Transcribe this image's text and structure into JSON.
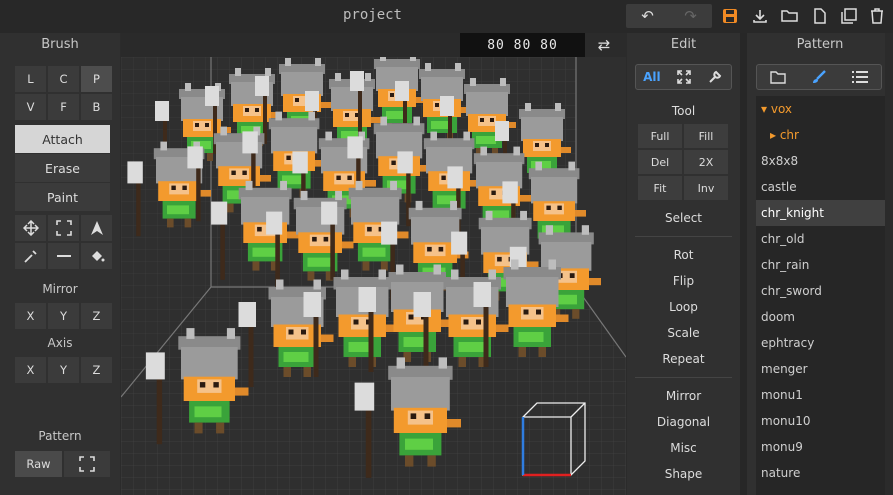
{
  "app": {
    "title": "project"
  },
  "toolbar": {
    "undo": "↶",
    "redo": "↷",
    "icons": [
      "save-icon",
      "import-icon",
      "open-folder-icon",
      "new-file-icon",
      "duplicate-icon",
      "trash-icon"
    ]
  },
  "brush": {
    "header": "Brush",
    "modes": [
      "L",
      "C",
      "P",
      "V",
      "F",
      "B"
    ],
    "selected_mode": "P",
    "actions": [
      "Attach",
      "Erase",
      "Paint"
    ],
    "selected_action": "Attach",
    "mirror_label": "Mirror",
    "mirror": [
      "X",
      "Y",
      "Z"
    ],
    "axis_label": "Axis",
    "axis": [
      "X",
      "Y",
      "Z"
    ],
    "pattern_label": "Pattern",
    "pattern_raw": "Raw"
  },
  "viewport": {
    "dims": "80  80  80"
  },
  "edit": {
    "header": "Edit",
    "tabs": {
      "all": "All"
    },
    "tool_label": "Tool",
    "tools": [
      "Full",
      "Fill",
      "Del",
      "2X",
      "Fit",
      "Inv"
    ],
    "select_label": "Select",
    "ops": [
      "Rot",
      "Flip",
      "Loop",
      "Scale",
      "Repeat"
    ],
    "ops2": [
      "Mirror",
      "Diagonal",
      "Misc",
      "Shape"
    ]
  },
  "pattern": {
    "header": "Pattern",
    "items": [
      {
        "label": "▾ vox",
        "kind": "folder"
      },
      {
        "label": "▸ chr",
        "kind": "folder-sub"
      },
      {
        "label": "8x8x8",
        "kind": "item"
      },
      {
        "label": "castle",
        "kind": "item"
      },
      {
        "label": "chr_knight",
        "kind": "selected"
      },
      {
        "label": "chr_old",
        "kind": "item"
      },
      {
        "label": "chr_rain",
        "kind": "item"
      },
      {
        "label": "chr_sword",
        "kind": "item"
      },
      {
        "label": "doom",
        "kind": "item"
      },
      {
        "label": "ephtracy",
        "kind": "item"
      },
      {
        "label": "menger",
        "kind": "item"
      },
      {
        "label": "monu1",
        "kind": "item"
      },
      {
        "label": "monu10",
        "kind": "item"
      },
      {
        "label": "monu9",
        "kind": "item"
      },
      {
        "label": "nature",
        "kind": "item"
      }
    ]
  },
  "colors": {
    "accent": "#4aa3ff",
    "folder": "#f39a2d",
    "save": "#f08a24"
  }
}
